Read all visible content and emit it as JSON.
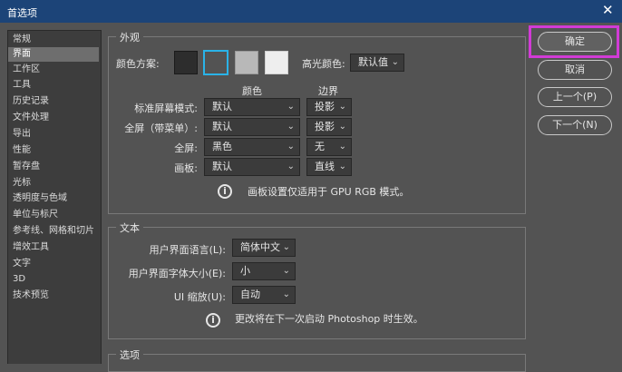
{
  "window": {
    "title": "首选项",
    "close_glyph": "✕"
  },
  "sidebar": {
    "items": [
      {
        "label": "常规"
      },
      {
        "label": "界面",
        "selected": true
      },
      {
        "label": "工作区"
      },
      {
        "label": "工具"
      },
      {
        "label": "历史记录"
      },
      {
        "label": "文件处理"
      },
      {
        "label": "导出"
      },
      {
        "label": "性能"
      },
      {
        "label": "暂存盘"
      },
      {
        "label": "光标"
      },
      {
        "label": "透明度与色域"
      },
      {
        "label": "单位与标尺"
      },
      {
        "label": "参考线、网格和切片"
      },
      {
        "label": "增效工具"
      },
      {
        "label": "文字"
      },
      {
        "label": "3D"
      },
      {
        "label": "技术预览"
      }
    ]
  },
  "appearance": {
    "title": "外观",
    "color_theme_label": "颜色方案:",
    "swatches": [
      {
        "color": "#2d2d2d",
        "selected": false
      },
      {
        "color": "#535353",
        "selected": true
      },
      {
        "color": "#b8b8b8",
        "selected": false
      },
      {
        "color": "#eeeeee",
        "selected": false
      }
    ],
    "highlight_label": "高光颜色:",
    "highlight_value": "默认值",
    "col_color": "颜色",
    "col_border": "边界",
    "rows": [
      {
        "label": "标准屏幕模式:",
        "color": "默认",
        "border": "投影"
      },
      {
        "label": "全屏（带菜单）:",
        "color": "默认",
        "border": "投影"
      },
      {
        "label": "全屏:",
        "color": "黑色",
        "border": "无"
      },
      {
        "label": "画板:",
        "color": "默认",
        "border": "直线"
      }
    ],
    "note": "画板设置仅适用于 GPU RGB 模式。"
  },
  "text_section": {
    "title": "文本",
    "ui_language_label": "用户界面语言(L):",
    "ui_language_value": "简体中文",
    "ui_font_size_label": "用户界面字体大小(E):",
    "ui_font_size_value": "小",
    "ui_scaling_label": "UI 缩放(U):",
    "ui_scaling_value": "自动",
    "note": "更改将在下一次启动 Photoshop 时生效。"
  },
  "options_section": {
    "title": "选项"
  },
  "buttons": {
    "ok": "确定",
    "cancel": "取消",
    "prev": "上一个(P)",
    "next": "下一个(N)"
  },
  "colors": {
    "titlebar": "#1c4478",
    "dialog_bg": "#535353",
    "highlight_outline": "#d23bd6"
  }
}
